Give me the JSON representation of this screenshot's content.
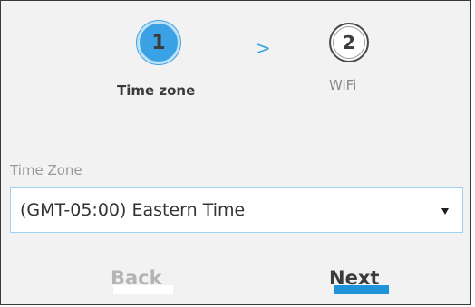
{
  "stepper": {
    "steps": [
      {
        "number": "1",
        "label": "Time zone",
        "active": true
      },
      {
        "number": "2",
        "label": "WiFi",
        "active": false
      }
    ],
    "separator": ">"
  },
  "time_zone": {
    "label": "Time Zone",
    "selected": "(GMT-05:00) Eastern Time"
  },
  "actions": {
    "back_label": "Back",
    "next_label": "Next"
  },
  "colors": {
    "accent": "#3aa2e4",
    "next_bar": "#1f94d9",
    "panel_bg": "#f2f2f2",
    "inactive_text": "#b4b4b4"
  }
}
